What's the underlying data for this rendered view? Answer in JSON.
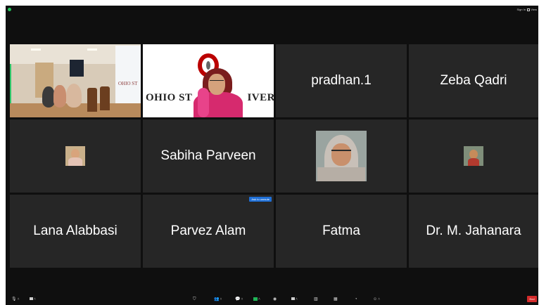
{
  "topbar": {
    "sign_in": "Sign In",
    "view": "View"
  },
  "participants": [
    {
      "name": "",
      "type": "video-room"
    },
    {
      "name": "",
      "type": "video-speaker",
      "backdrop_text": "OHIO STATE UNIVERSITY"
    },
    {
      "name": "pradhan.1",
      "type": "name-only"
    },
    {
      "name": "Zeba Qadri",
      "type": "name-only"
    },
    {
      "name": "",
      "type": "avatar"
    },
    {
      "name": "Sabiha Parveen",
      "type": "name-only"
    },
    {
      "name": "",
      "type": "avatar"
    },
    {
      "name": "",
      "type": "avatar"
    },
    {
      "name": "Lana Alabbasi",
      "type": "name-only"
    },
    {
      "name": "Parvez Alam",
      "type": "name-only"
    },
    {
      "name": "Fatma",
      "type": "name-only"
    },
    {
      "name": "Dr. M. Jahanara",
      "type": "name-only"
    }
  ],
  "room_video": {
    "screen_text": "OHIO ST"
  },
  "speaker_video": {
    "backdrop_left": "OHIO ST",
    "backdrop_right": "IVER"
  },
  "admit_badge": "Ask to unmute",
  "toolbar": {
    "end_label": "End"
  },
  "colors": {
    "background": "#0f0f0f",
    "tile": "#262626",
    "active_speaker_border": "#2ec66a",
    "end_button": "#d42b2b",
    "badge": "#1f6fd6"
  }
}
